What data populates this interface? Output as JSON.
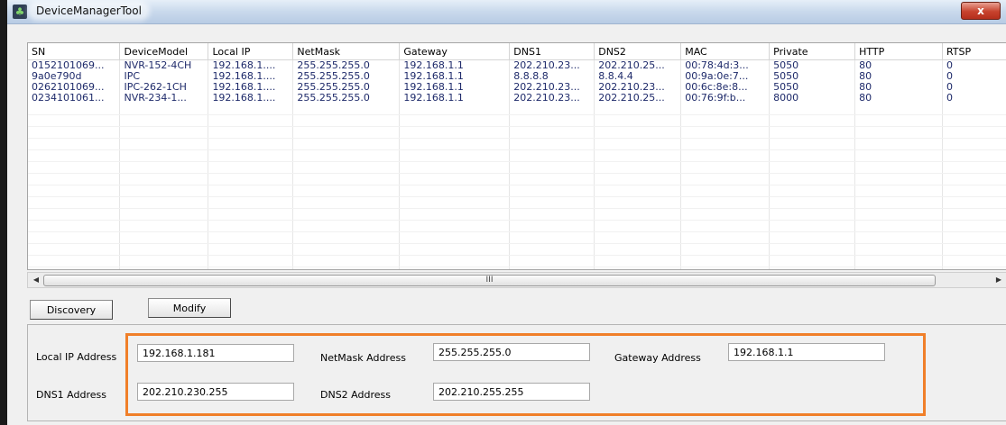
{
  "window": {
    "title": "DeviceManagerTool",
    "close_glyph": "x",
    "icon": "app-icon"
  },
  "table": {
    "columns": [
      "SN",
      "DeviceModel",
      "Local IP",
      "NetMask",
      "Gateway",
      "DNS1",
      "DNS2",
      "MAC",
      "Private",
      "HTTP",
      "RTSP"
    ],
    "rows": [
      [
        "0152101069...",
        "NVR-152-4CH",
        "192.168.1....",
        "255.255.255.0",
        "192.168.1.1",
        "202.210.23...",
        "202.210.25...",
        "00:78:4d:3...",
        "5050",
        "80",
        "0"
      ],
      [
        "9a0e790d",
        "IPC",
        "192.168.1....",
        "255.255.255.0",
        "192.168.1.1",
        "8.8.8.8",
        "8.8.4.4",
        "00:9a:0e:7...",
        "5050",
        "80",
        "0"
      ],
      [
        "0262101069...",
        "IPC-262-1CH",
        "192.168.1....",
        "255.255.255.0",
        "192.168.1.1",
        "202.210.23...",
        "202.210.23...",
        "00:6c:8e:8...",
        "5050",
        "80",
        "0"
      ],
      [
        "0234101061...",
        "NVR-234-1...",
        "192.168.1....",
        "255.255.255.0",
        "192.168.1.1",
        "202.210.23...",
        "202.210.25...",
        "00:76:9f:b...",
        "8000",
        "80",
        "0"
      ]
    ]
  },
  "scrollbar": {
    "left_arrow": "◀",
    "right_arrow": "▶",
    "grip": "III"
  },
  "buttons": {
    "discovery": "Discovery",
    "modify": "Modify"
  },
  "form": {
    "local_ip_label": "Local IP Address",
    "local_ip_value": "192.168.1.181",
    "netmask_label": "NetMask Address",
    "netmask_value": "255.255.255.0",
    "gateway_label": "Gateway Address",
    "gateway_value": "192.168.1.1",
    "dns1_label": "DNS1 Address",
    "dns1_value": "202.210.230.255",
    "dns2_label": "DNS2 Address",
    "dns2_value": "202.210.255.255"
  },
  "colors": {
    "highlight": "#f07f29",
    "cell_text": "#1e2a6a"
  }
}
